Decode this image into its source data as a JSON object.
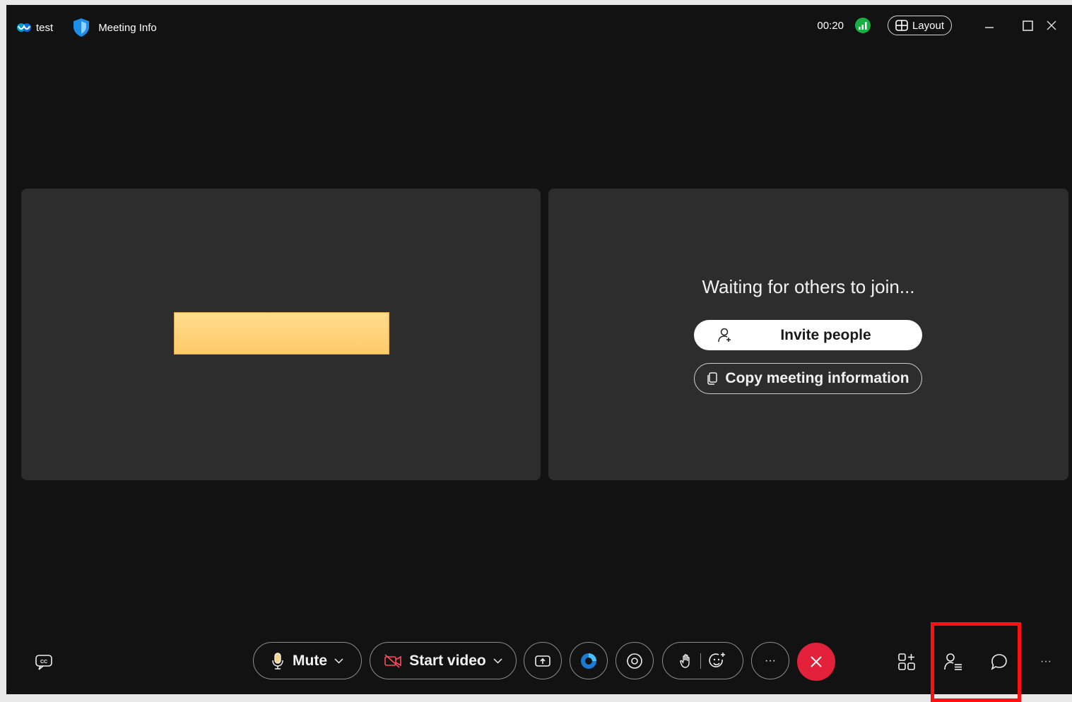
{
  "titlebar": {
    "app_name": "test",
    "meeting_info_label": "Meeting Info",
    "timer": "00:20",
    "layout_label": "Layout",
    "icons": [
      "webex-logo-icon",
      "shield-icon",
      "signal-strength-icon",
      "layout-grid-icon",
      "minimize-icon",
      "maximize-icon",
      "close-icon"
    ]
  },
  "stage": {
    "waiting_text": "Waiting for others to join...",
    "invite_label": "Invite people",
    "copy_label": "Copy meeting information"
  },
  "controls": {
    "mute_label": "Mute",
    "video_label": "Start video",
    "more_label": "···",
    "side_more_label": "···",
    "icons": [
      "captions-icon",
      "microphone-icon",
      "video-off-icon",
      "share-screen-icon",
      "ai-assistant-icon",
      "record-icon",
      "raise-hand-icon",
      "reactions-icon",
      "more-icon",
      "end-call-icon",
      "apps-icon",
      "participants-icon",
      "chat-icon"
    ]
  },
  "colors": {
    "background": "#121212",
    "pane": "#2d2d2d",
    "end_call": "#e3213a",
    "signal": "#17b042",
    "highlight": "#ff1010",
    "name_tag": "#ffd27a"
  }
}
